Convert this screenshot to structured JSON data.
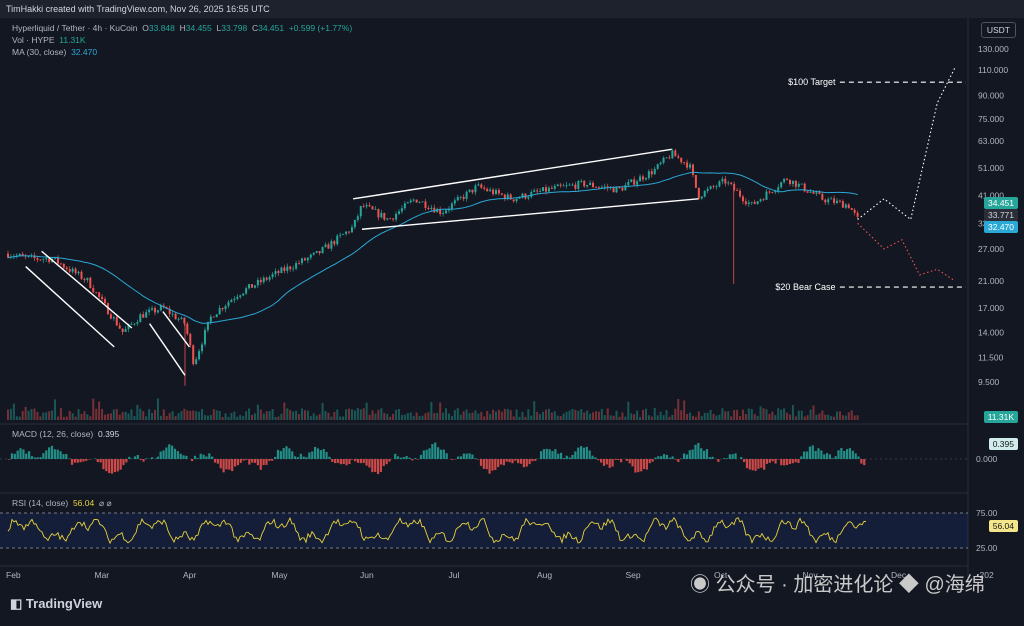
{
  "header": {
    "credit": "TimHakki created with TradingView.com, Nov 26, 2025 16:55 UTC"
  },
  "legend": {
    "symbol": "Hyperliquid / Tether · 4h · KuCoin",
    "ohlc": {
      "o_label": "O",
      "o": "33.848",
      "h_label": "H",
      "h": "34.455",
      "l_label": "L",
      "l": "33.798",
      "c_label": "C",
      "c": "34.451",
      "change": "+0.599 (+1.77%)"
    },
    "vol_label": "Vol · HYPE",
    "vol_value": "11.31K",
    "ma_label": "MA (30, close)",
    "ma_value": "32.470"
  },
  "currency": "USDT",
  "annotations": {
    "target": "$100 Target",
    "bear": "$20 Bear Case"
  },
  "macd": {
    "label": "MACD (12, 26, close)",
    "value": "0.395",
    "badge": "0.395"
  },
  "rsi": {
    "label": "RSI (14, close)",
    "value": "56.04",
    "extra": "⌀ ⌀",
    "badge": "56.04"
  },
  "price_badges": {
    "close": "34.451",
    "prev": "33.771",
    "ma": "32.470",
    "vol": "11.31K"
  },
  "branding": {
    "logo": "TradingView",
    "watermark_a": "公众号 · 加密进化论",
    "watermark_b": "@海绵"
  },
  "colors": {
    "bg": "#131722",
    "up": "#26a69a",
    "down": "#ef5350",
    "ma": "#2aa9d6",
    "rsi": "#e8d23a",
    "channel": "#ffffff"
  },
  "chart_data": {
    "type": "candlestick",
    "symbol": "Hyperliquid / Tether",
    "interval": "4h",
    "y_scale": "log",
    "ylim": [
      8.5,
      135
    ],
    "y_ticks": [
      130,
      110,
      90,
      75,
      63,
      51,
      41,
      33,
      27,
      21,
      17,
      14,
      11.5,
      9.5
    ],
    "y_tick_labels": [
      "130.000",
      "110.000",
      "90.000",
      "75.000",
      "63.000",
      "51.000",
      "41.000",
      "33.000",
      "27.000",
      "21.000",
      "17.000",
      "14.000",
      "11.500",
      "9.500"
    ],
    "x_tick_labels": [
      "Feb",
      "Mar",
      "Apr",
      "May",
      "Jun",
      "Jul",
      "Aug",
      "Sep",
      "Oct",
      "Nov",
      "Dec",
      "202"
    ],
    "price_path": [
      {
        "m": 0.0,
        "p": 26
      },
      {
        "m": 0.25,
        "p": 25
      },
      {
        "m": 0.5,
        "p": 25
      },
      {
        "m": 0.9,
        "p": 21
      },
      {
        "m": 1.3,
        "p": 14
      },
      {
        "m": 1.5,
        "p": 16
      },
      {
        "m": 1.75,
        "p": 17
      },
      {
        "m": 2.0,
        "p": 15
      },
      {
        "m": 2.1,
        "p": 11
      },
      {
        "m": 2.3,
        "p": 16
      },
      {
        "m": 2.6,
        "p": 19
      },
      {
        "m": 3.0,
        "p": 22
      },
      {
        "m": 3.5,
        "p": 26
      },
      {
        "m": 3.9,
        "p": 32
      },
      {
        "m": 4.0,
        "p": 38
      },
      {
        "m": 4.3,
        "p": 34
      },
      {
        "m": 4.6,
        "p": 40
      },
      {
        "m": 4.9,
        "p": 36
      },
      {
        "m": 5.3,
        "p": 44
      },
      {
        "m": 5.7,
        "p": 40
      },
      {
        "m": 6.1,
        "p": 43
      },
      {
        "m": 6.5,
        "p": 45
      },
      {
        "m": 6.9,
        "p": 43
      },
      {
        "m": 7.3,
        "p": 50
      },
      {
        "m": 7.5,
        "p": 57
      },
      {
        "m": 7.7,
        "p": 52
      },
      {
        "m": 7.8,
        "p": 41
      },
      {
        "m": 8.1,
        "p": 46
      },
      {
        "m": 8.4,
        "p": 38
      },
      {
        "m": 8.8,
        "p": 47
      },
      {
        "m": 9.2,
        "p": 40
      },
      {
        "m": 9.5,
        "p": 38
      },
      {
        "m": 9.6,
        "p": 34
      }
    ],
    "ma30_last": 32.47,
    "channels": [
      {
        "name": "falling-channel-1",
        "upper": [
          [
            0.38,
            26.5
          ],
          [
            1.4,
            14.5
          ]
        ],
        "lower": [
          [
            0.2,
            23.5
          ],
          [
            1.2,
            12.5
          ]
        ]
      },
      {
        "name": "falling-channel-2",
        "upper": [
          [
            1.75,
            16.5
          ],
          [
            2.05,
            12.5
          ]
        ],
        "lower": [
          [
            1.6,
            15
          ],
          [
            2.0,
            10
          ]
        ]
      },
      {
        "name": "rising-channel",
        "upper": [
          [
            3.9,
            40
          ],
          [
            7.5,
            59
          ]
        ],
        "lower": [
          [
            4.0,
            31.5
          ],
          [
            7.8,
            40
          ]
        ]
      }
    ],
    "projections": [
      {
        "name": "bull-path",
        "color": "#ffffff",
        "points": [
          [
            9.6,
            34
          ],
          [
            9.9,
            40
          ],
          [
            10.2,
            34
          ],
          [
            10.5,
            85
          ],
          [
            10.7,
            112
          ]
        ]
      },
      {
        "name": "bear-path",
        "color": "#ef5350",
        "points": [
          [
            9.6,
            33
          ],
          [
            9.9,
            27
          ],
          [
            10.1,
            29
          ],
          [
            10.3,
            22
          ],
          [
            10.5,
            23
          ],
          [
            10.7,
            21
          ]
        ]
      }
    ],
    "levels": [
      {
        "name": "target",
        "value": 100
      },
      {
        "name": "bear-case",
        "value": 20
      }
    ],
    "last": {
      "open": 33.848,
      "high": 34.455,
      "low": 33.798,
      "close": 34.451,
      "change": 0.599,
      "change_pct": 1.77
    },
    "volume_last": "11.31K",
    "macd": {
      "fast": 12,
      "slow": 26,
      "value": 0.395,
      "zero": 0
    },
    "macd_ticks": [
      "0.000"
    ],
    "rsi": {
      "length": 14,
      "value": 56.04,
      "bands": [
        75,
        25
      ],
      "ticks": [
        "75.00",
        "25.00"
      ]
    }
  }
}
